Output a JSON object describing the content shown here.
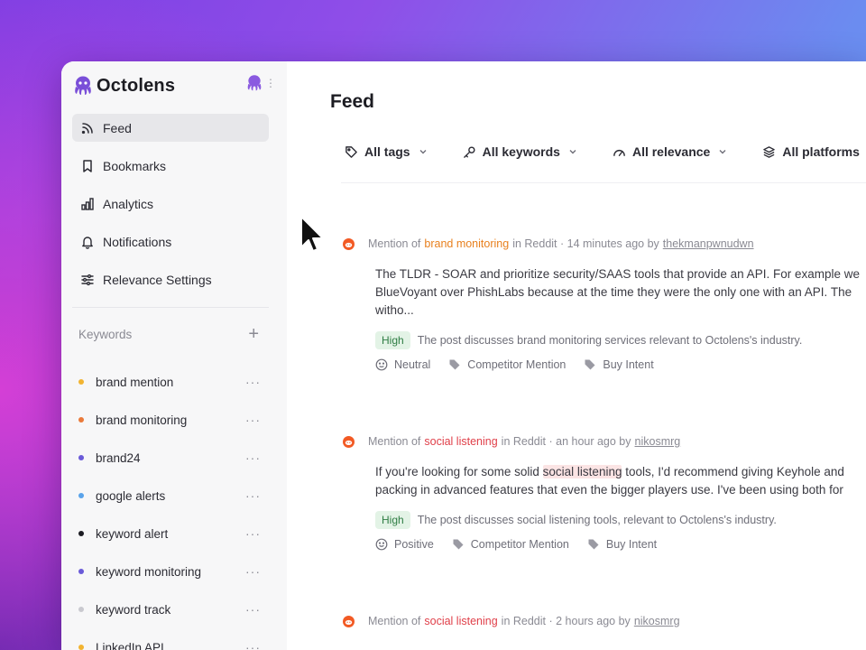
{
  "app": {
    "name": "Octolens"
  },
  "sidebar": {
    "nav": [
      {
        "label": "Feed",
        "icon": "rss-icon",
        "active": true
      },
      {
        "label": "Bookmarks",
        "icon": "bookmark-icon",
        "active": false
      },
      {
        "label": "Analytics",
        "icon": "bar-chart-icon",
        "active": false
      },
      {
        "label": "Notifications",
        "icon": "bell-icon",
        "active": false
      },
      {
        "label": "Relevance Settings",
        "icon": "sliders-icon",
        "active": false
      }
    ],
    "keywords_title": "Keywords",
    "keywords_add": "+",
    "keywords": [
      {
        "label": "brand mention",
        "color": "#f2b431"
      },
      {
        "label": "brand monitoring",
        "color": "#ea7a3a"
      },
      {
        "label": "brand24",
        "color": "#6a5ad8"
      },
      {
        "label": "google alerts",
        "color": "#5aa3ea"
      },
      {
        "label": "keyword alert",
        "color": "#1c1c22"
      },
      {
        "label": "keyword monitoring",
        "color": "#6a5ad8"
      },
      {
        "label": "keyword track",
        "color": "#c9c9cf"
      },
      {
        "label": "LinkedIn API",
        "color": "#f2b431"
      }
    ],
    "more_label": "···"
  },
  "main": {
    "title": "Feed",
    "filters": [
      {
        "label": "All tags",
        "icon": "tag-icon"
      },
      {
        "label": "All keywords",
        "icon": "key-icon"
      },
      {
        "label": "All relevance",
        "icon": "gauge-icon"
      },
      {
        "label": "All platforms",
        "icon": "layers-icon"
      }
    ],
    "posts": [
      {
        "prefix": "Mention of",
        "keyword": "brand monitoring",
        "suffix": "in Reddit · 14 minutes ago by",
        "author": "thekmanpwnudwn",
        "lines": [
          "The TLDR - SOAR and prioritize security/SAAS tools that provide an API. For example we",
          "BlueVoyant over PhishLabs because at the time they were the only one with an API. The",
          "witho..."
        ],
        "relevance": "High",
        "reason": "The post discusses brand monitoring services relevant to Octolens's industry.",
        "sentiment": "Neutral",
        "tags": [
          "Competitor Mention",
          "Buy Intent"
        ]
      },
      {
        "prefix": "Mention of",
        "keyword": "social listening",
        "suffix": "in Reddit · an hour ago by",
        "author": "nikosmrg",
        "line1_pre": "If you're looking for some solid ",
        "line1_hl": "social listening",
        "line1_post": " tools, I'd recommend giving Keyhole and",
        "line2": "packing in advanced features that even the bigger players use. I've been using both for",
        "relevance": "High",
        "reason": "The post discusses social listening tools, relevant to Octolens's industry.",
        "sentiment": "Positive",
        "tags": [
          "Competitor Mention",
          "Buy Intent"
        ]
      },
      {
        "prefix": "Mention of",
        "keyword": "social listening",
        "suffix": "in Reddit · 2 hours ago by",
        "author": "nikosmrg"
      }
    ]
  }
}
